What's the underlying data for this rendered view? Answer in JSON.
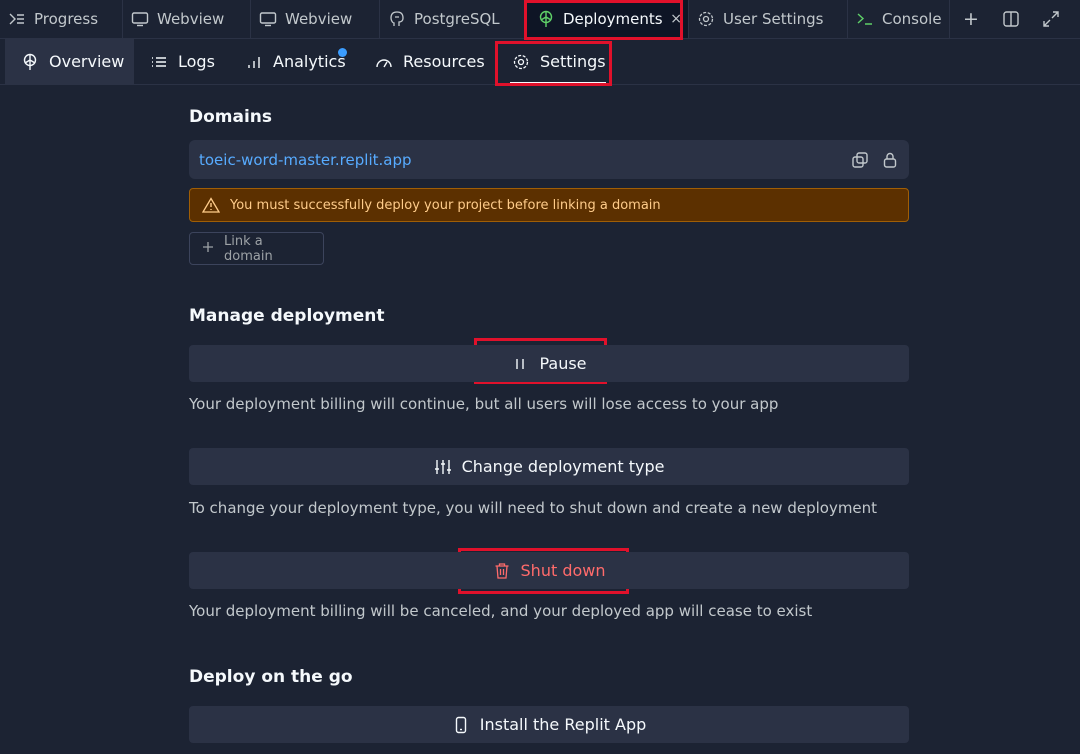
{
  "tabs": [
    {
      "label": "Progress",
      "icon": "progress-icon",
      "active": false
    },
    {
      "label": "Webview",
      "icon": "monitor-icon",
      "active": false
    },
    {
      "label": "Webview",
      "icon": "monitor-icon",
      "active": false
    },
    {
      "label": "PostgreSQL",
      "icon": "postgres-icon",
      "active": false
    },
    {
      "label": "Deployments",
      "icon": "deployments-icon",
      "active": true,
      "close": "×"
    },
    {
      "label": "User Settings",
      "icon": "gear-icon",
      "active": false
    },
    {
      "label": "Console",
      "icon": "console-icon",
      "active": false
    }
  ],
  "tab_actions": {
    "add": "+"
  },
  "subtabs": [
    {
      "label": "Overview",
      "icon": "deployments-icon",
      "active": true
    },
    {
      "label": "Logs",
      "icon": "list-icon",
      "active": false
    },
    {
      "label": "Analytics",
      "icon": "bar-chart-icon",
      "active": false,
      "badge_dot": true
    },
    {
      "label": "Resources",
      "icon": "gauge-icon",
      "active": false
    },
    {
      "label": "Settings",
      "icon": "gear-icon",
      "active": false,
      "underline": true
    }
  ],
  "domains": {
    "title": "Domains",
    "url": "toeic-word-master.replit.app",
    "warning": "You must successfully deploy your project before linking a domain",
    "link_button": "Link a domain"
  },
  "manage": {
    "title": "Manage deployment",
    "pause_label": "Pause",
    "pause_desc": "Your deployment billing will continue, but all users will lose access to your app",
    "change_label": "Change deployment type",
    "change_desc": "To change your deployment type, you will need to shut down and create a new deployment",
    "shutdown_label": "Shut down",
    "shutdown_desc": "Your deployment billing will be canceled, and your deployed app will cease to exist"
  },
  "deploy_go": {
    "title": "Deploy on the go",
    "install_label": "Install the Replit App"
  },
  "colors": {
    "background": "#1c2333",
    "surface": "#2b3245",
    "link": "#57abff",
    "danger": "#ff6b6b",
    "highlight": "#e0112b",
    "warning_bg": "#5c3000"
  }
}
